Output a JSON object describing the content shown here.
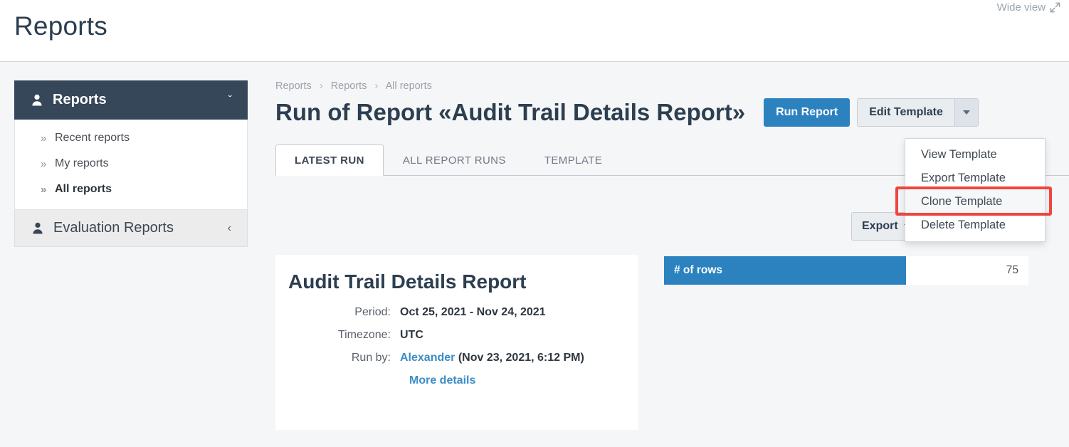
{
  "header": {
    "title": "Reports",
    "wide_view_label": "Wide view",
    "wide_view_icon": "expand-arrows-icon"
  },
  "sidebar": {
    "group": {
      "label": "Reports",
      "icon": "user-icon",
      "chevron": "chevron-down-icon",
      "chevron_glyph": "ˇ"
    },
    "items": [
      {
        "label": "Recent reports",
        "marker": "»",
        "active": false
      },
      {
        "label": "My reports",
        "marker": "»",
        "active": false
      },
      {
        "label": "All reports",
        "marker": "»",
        "active": true
      }
    ],
    "footer": {
      "label": "Evaluation Reports",
      "icon": "user-icon",
      "chevron": "chevron-left-icon",
      "chevron_glyph": "‹"
    }
  },
  "breadcrumb": {
    "items": [
      "Reports",
      "Reports",
      "All reports"
    ],
    "separator": "›"
  },
  "page": {
    "run_title": "Run of Report «Audit Trail Details Report»"
  },
  "actions": {
    "run_report": "Run Report",
    "edit_template": "Edit Template",
    "caret_icon": "caret-down-icon",
    "export": "Export"
  },
  "dropdown": {
    "items": [
      {
        "label": "View Template",
        "highlighted": false
      },
      {
        "label": "Export Template",
        "highlighted": false
      },
      {
        "label": "Clone Template",
        "highlighted": true
      },
      {
        "label": "Delete Template",
        "highlighted": false
      }
    ],
    "highlight_color": "#f0453f"
  },
  "tabs": [
    {
      "label": "Latest run",
      "active": true
    },
    {
      "label": "All report runs",
      "active": false
    },
    {
      "label": "Template",
      "active": false
    }
  ],
  "report_card": {
    "title": "Audit Trail Details Report",
    "rows": [
      {
        "label": "Period:",
        "value": "Oct 25, 2021 - Nov 24, 2021"
      },
      {
        "label": "Timezone:",
        "value": "UTC"
      }
    ],
    "run_by_label": "Run by:",
    "run_by_user": "Alexander",
    "run_by_time": "(Nov 23, 2021, 6:12 PM)",
    "more_details": "More details"
  },
  "rows_table": {
    "header": "# of rows",
    "value": "75",
    "accent_color": "#2b82bf"
  }
}
